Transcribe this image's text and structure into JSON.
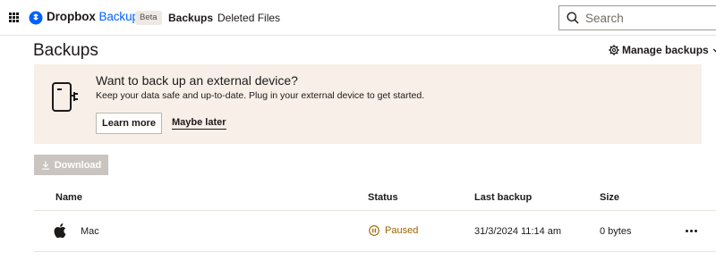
{
  "header": {
    "brand_name": "Dropbox",
    "product_name": "Backup",
    "beta_badge": "Beta",
    "nav": [
      {
        "label": "Backups",
        "active": true
      },
      {
        "label": "Deleted Files",
        "active": false
      }
    ],
    "search": {
      "placeholder": "Search",
      "value": ""
    }
  },
  "page": {
    "title": "Backups",
    "manage_label": "Manage backups"
  },
  "banner": {
    "title": "Want to back up an external device?",
    "text": "Keep your data safe and up-to-date. Plug in your external device to get started.",
    "learn_more": "Learn more",
    "maybe_later": "Maybe later",
    "icon": "external-device-icon"
  },
  "download": {
    "label": "Download",
    "enabled": false
  },
  "table": {
    "columns": [
      "Name",
      "Status",
      "Last backup",
      "Size"
    ],
    "rows": [
      {
        "icon": "apple-icon",
        "name": "Mac",
        "status": "Paused",
        "last_backup": "31/3/2024 11:14 am",
        "size": "0 bytes"
      }
    ]
  },
  "colors": {
    "brand_blue": "#0061fe",
    "banner_bg": "#f7efe8",
    "status_paused": "#9b6400",
    "disabled_button": "#c9c4bf"
  }
}
